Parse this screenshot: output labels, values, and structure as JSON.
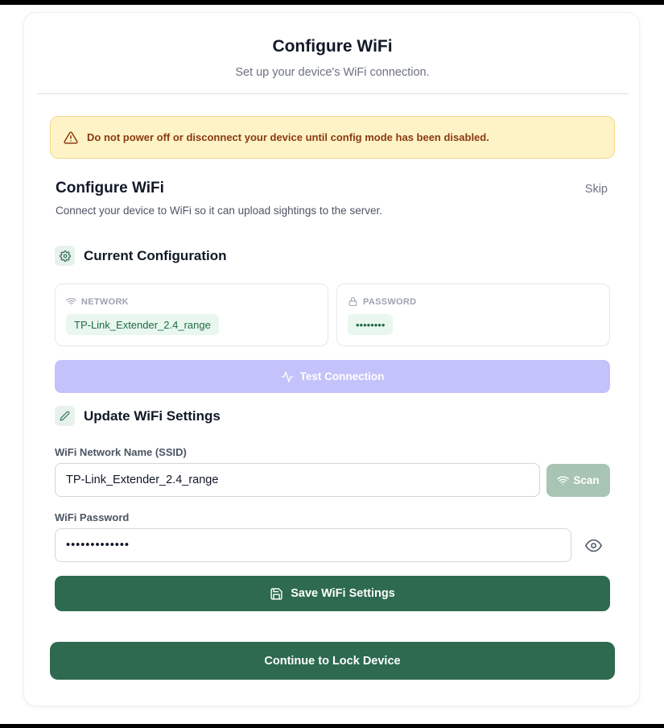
{
  "header": {
    "title": "Configure WiFi",
    "subtitle": "Set up your device's WiFi connection."
  },
  "warning": {
    "text": "Do not power off or disconnect your device until config mode has been disabled.",
    "icon": "warning-triangle-icon",
    "color": "#8a3a10"
  },
  "section": {
    "title": "Configure WiFi",
    "skip_label": "Skip",
    "description": "Connect your device to WiFi so it can upload sightings to the server."
  },
  "current_config": {
    "heading": "Current Configuration",
    "icon": "gear-icon",
    "network_label": "NETWORK",
    "network_value": "TP-Link_Extender_2.4_range",
    "password_label": "PASSWORD",
    "password_value": "••••••••",
    "test_button_label": "Test Connection"
  },
  "update": {
    "heading": "Update WiFi Settings",
    "icon": "pencil-icon",
    "ssid_label": "WiFi Network Name (SSID)",
    "ssid_value": "TP-Link_Extender_2.4_range",
    "scan_label": "Scan",
    "password_label": "WiFi Password",
    "password_value": "•••••••••••••",
    "save_label": "Save WiFi Settings"
  },
  "footer": {
    "continue_label": "Continue to Lock Device"
  },
  "colors": {
    "primary": "#2d6a4f",
    "disabled_accent": "#c4c2fa",
    "scan_disabled": "#a8c4b4",
    "warning_bg": "#fef3c7"
  }
}
